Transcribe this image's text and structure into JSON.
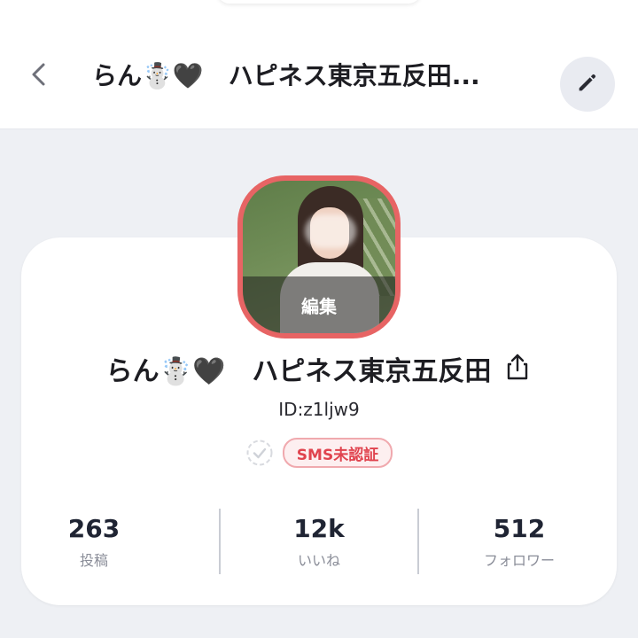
{
  "header": {
    "title": "らん☃️🖤　ハピネス東京五反田..."
  },
  "profile": {
    "avatar_overlay_label": "編集",
    "name": "らん☃️🖤　ハピネス東京五反田",
    "id_text": "ID:z1ljw9",
    "sms_badge": "SMS未認証"
  },
  "stats": [
    {
      "value": "263",
      "label": "投稿"
    },
    {
      "value": "12k",
      "label": "いいね"
    },
    {
      "value": "512",
      "label": "フォロワー"
    }
  ],
  "icons": {
    "back": "chevron-left-icon",
    "edit": "pencil-icon",
    "share": "share-icon",
    "verify": "check-circle-icon"
  },
  "colors": {
    "background": "#eef0f4",
    "avatar_border": "#e76464",
    "sms_badge_text": "#e0434e",
    "stat_value": "#1f2433"
  }
}
